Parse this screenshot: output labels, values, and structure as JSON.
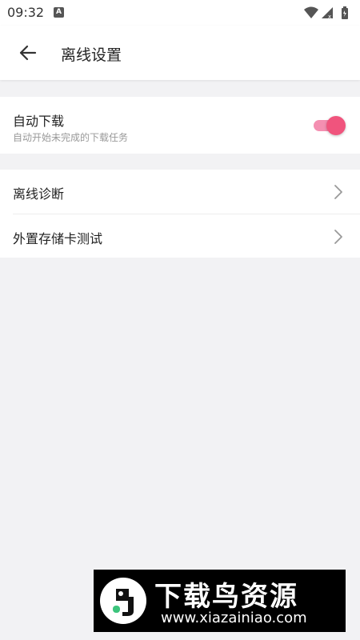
{
  "status_bar": {
    "time": "09:32",
    "notification_glyph": "A",
    "icons": [
      "wifi-icon",
      "signal-icon",
      "battery-icon"
    ]
  },
  "toolbar": {
    "title": "离线设置",
    "back_icon": "arrow-left-icon"
  },
  "auto_download": {
    "title": "自动下载",
    "description": "自动开始未完成的下载任务",
    "enabled": true,
    "accent_color": "#f0547d"
  },
  "menu": {
    "items": [
      {
        "label": "离线诊断",
        "icon": "chevron-right-icon"
      },
      {
        "label": "外置存储卡测试",
        "icon": "chevron-right-icon"
      }
    ]
  },
  "watermark": {
    "title": "下载鸟资源",
    "url": "www.xiazainiao.com"
  }
}
